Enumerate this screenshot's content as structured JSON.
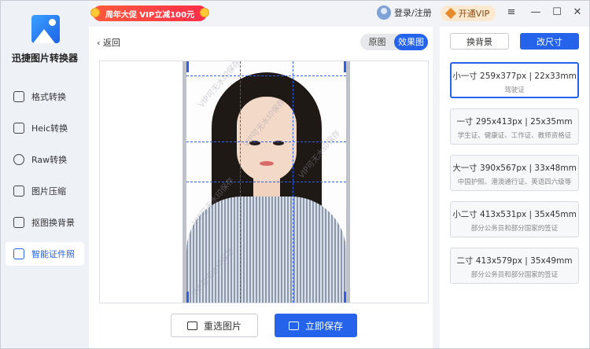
{
  "app": {
    "name": "迅捷图片转换器"
  },
  "sidebar": {
    "items": [
      {
        "label": "格式转换",
        "icon": "convert-icon"
      },
      {
        "label": "Heic转换",
        "icon": "heic-icon"
      },
      {
        "label": "Raw转换",
        "icon": "raw-icon"
      },
      {
        "label": "图片压缩",
        "icon": "compress-icon"
      },
      {
        "label": "抠图换背景",
        "icon": "cutout-icon"
      },
      {
        "label": "智能证件照",
        "icon": "id-photo-icon",
        "active": true
      }
    ]
  },
  "titlebar": {
    "promo": "周年大促 VIP立减100元",
    "login": "登录/注册",
    "vip": "开通VIP",
    "menu_icon": "≡",
    "minimize_icon": "—",
    "maximize_icon": "☐",
    "close_icon": "✕"
  },
  "main": {
    "back_label": "返回",
    "toggle": {
      "original": "原图",
      "result": "效果图",
      "selected": "效果图"
    },
    "watermark": "VIP可无水印保存",
    "reselect_label": "重选图片",
    "save_label": "立即保存"
  },
  "right": {
    "tab_background": "换背景",
    "tab_resize": "改尺寸",
    "sizes": [
      {
        "title": "小一寸 259x377px | 22x33mm",
        "desc": "驾驶证",
        "selected": true
      },
      {
        "title": "一寸 295x413px | 25x35mm",
        "desc": "学生证、健康证、工作证、教师资格证"
      },
      {
        "title": "大一寸 390x567px | 33x48mm",
        "desc": "中国护照、港澳通行证、英语四六级等"
      },
      {
        "title": "小二寸 413x531px | 35x45mm",
        "desc": "部分公务员和部分国家的签证"
      },
      {
        "title": "二寸 413x579px | 35x49mm",
        "desc": "部分公务员和部分国家的签证"
      }
    ]
  },
  "colors": {
    "accent": "#2563eb",
    "promo": "#ff3b47",
    "vip_bg": "#fde9cf"
  }
}
